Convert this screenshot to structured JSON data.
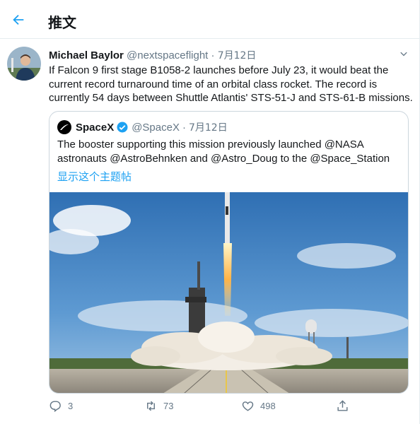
{
  "header": {
    "title": "推文",
    "back_icon": "arrow-left-icon",
    "accent": "#1da1f2"
  },
  "tweet": {
    "author_name": "Michael Baylor",
    "handle": "@nextspaceflight",
    "separator": "·",
    "date": "7月12日",
    "text": "If Falcon 9 first stage B1058-2 launches before July 23, it would beat the current record turnaround time of an orbital class rocket. The record is currently 54 days between Shuttle Atlantis' STS-51-J and STS-61-B missions."
  },
  "quote": {
    "author_name": "SpaceX",
    "handle": "@SpaceX",
    "separator": "·",
    "date": "7月12日",
    "text": "The booster supporting this mission previously launched @NASA astronauts @AstroBehnken and @Astro_Doug to the @Space_Station",
    "show_thread": "显示这个主题帖"
  },
  "actions": {
    "reply_count": "3",
    "retweet_count": "73",
    "like_count": "498"
  }
}
